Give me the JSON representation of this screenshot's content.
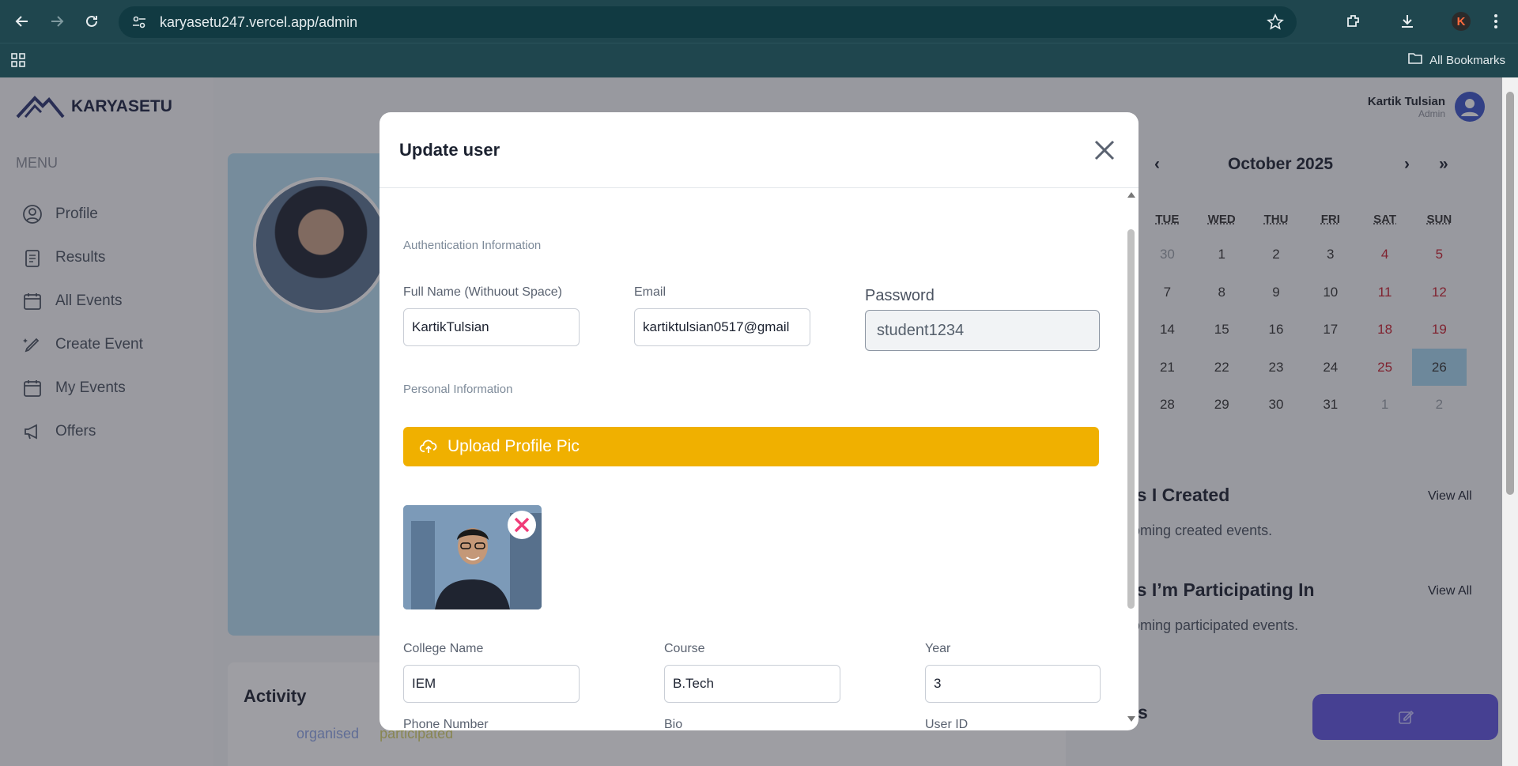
{
  "browser": {
    "url": "karyasetu247.vercel.app/admin",
    "bookmarks_label": "All Bookmarks",
    "profile_initial": "K"
  },
  "app": {
    "brand": "KARYASETU",
    "menu_label": "MENU",
    "menu": [
      {
        "label": "Profile",
        "icon": "user-circle-icon"
      },
      {
        "label": "Results",
        "icon": "clipboard-icon"
      },
      {
        "label": "All Events",
        "icon": "calendar-icon"
      },
      {
        "label": "Create Event",
        "icon": "pencil-sparkle-icon"
      },
      {
        "label": "My Events",
        "icon": "calendar-icon"
      },
      {
        "label": "Offers",
        "icon": "megaphone-icon"
      }
    ],
    "user": {
      "name": "Kartik Tulsian",
      "role": "Admin"
    },
    "activity_title": "Activity",
    "legend": {
      "organised": "organised",
      "participated": "participated"
    },
    "calendar": {
      "month": "October 2025",
      "headers": [
        "TUE",
        "WED",
        "THU",
        "FRI",
        "SAT",
        "SUN"
      ],
      "rows": [
        [
          "30",
          "1",
          "2",
          "3",
          "4",
          "5"
        ],
        [
          "7",
          "8",
          "9",
          "10",
          "11",
          "12"
        ],
        [
          "14",
          "15",
          "16",
          "17",
          "18",
          "19"
        ],
        [
          "21",
          "22",
          "23",
          "24",
          "25",
          "26"
        ],
        [
          "28",
          "29",
          "30",
          "31",
          "1",
          "2"
        ]
      ],
      "selected": "26"
    },
    "created": {
      "title": "ts I Created",
      "view_all": "View All",
      "sub": "oming created events."
    },
    "participating": {
      "title": "ts I’m Participating In",
      "view_all": "View All",
      "sub": "oming participated events."
    },
    "partial_title": "rs"
  },
  "modal": {
    "title": "Update user",
    "auth_section": "Authentication Information",
    "personal_section": "Personal Information",
    "fields": {
      "full_name": {
        "label": "Full Name (Withuout Space)",
        "value": "KartikTulsian"
      },
      "email": {
        "label": "Email",
        "value": "kartiktulsian0517@gmail"
      },
      "password": {
        "label": "Password",
        "value": "student1234"
      },
      "college": {
        "label": "College Name",
        "value": "IEM"
      },
      "course": {
        "label": "Course",
        "value": "B.Tech"
      },
      "year": {
        "label": "Year",
        "value": "3"
      },
      "phone": {
        "label": "Phone Number"
      },
      "bio": {
        "label": "Bio"
      },
      "user_id": {
        "label": "User ID"
      }
    },
    "upload_label": "Upload Profile Pic"
  },
  "colors": {
    "upload": "#f0b000",
    "chrome": "#1f464e",
    "weekend": "#c8202f",
    "selected_day": "#a7d8f0"
  }
}
